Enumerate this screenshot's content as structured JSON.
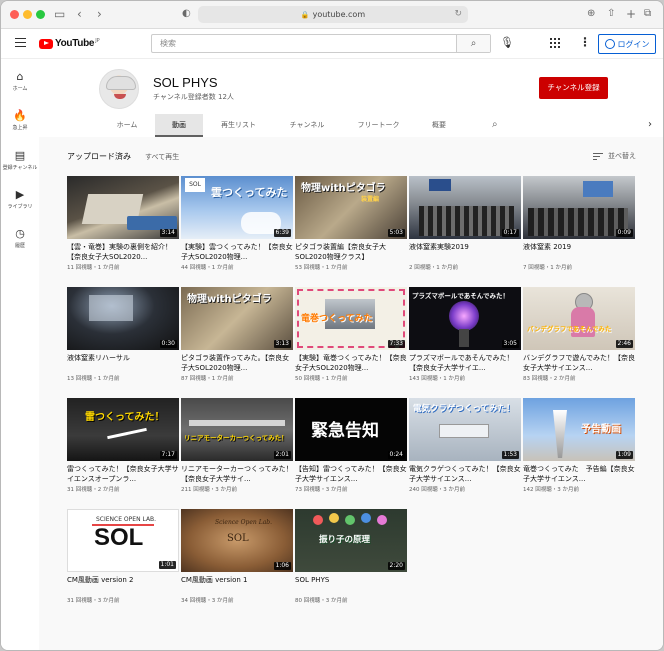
{
  "browser": {
    "url": "youtube.com"
  },
  "header": {
    "logo_text": "YouTube",
    "logo_region": "JP",
    "search_placeholder": "検索",
    "login_label": "ログイン"
  },
  "sidebar": {
    "items": [
      {
        "icon": "home-icon",
        "label": "ホーム",
        "glyph": "⌂"
      },
      {
        "icon": "explore-icon",
        "label": "急上昇",
        "glyph": "🔥"
      },
      {
        "icon": "subscriptions-icon",
        "label": "登録チャンネル",
        "glyph": "▤"
      },
      {
        "icon": "library-icon",
        "label": "ライブラリ",
        "glyph": "▶"
      },
      {
        "icon": "history-icon",
        "label": "履歴",
        "glyph": "◷"
      }
    ]
  },
  "channel": {
    "name": "SOL PHYS",
    "subscribers": "チャンネル登録者数 12人",
    "subscribe_label": "チャンネル登録",
    "tabs": [
      "ホーム",
      "動画",
      "再生リスト",
      "チャンネル",
      "フリートーク",
      "概要"
    ],
    "active_tab": 1
  },
  "videos_section": {
    "title": "アップロード済み",
    "play_all": "すべて再生",
    "sort_label": "並べ替え"
  },
  "videos": [
    {
      "title": "【雲・竜巻】実験の裏側を紹介！【奈良女子大SOL2020...",
      "meta": "11 回視聴・1 か月前",
      "duration": "3:14"
    },
    {
      "title": "【実験】雲つくってみた！【奈良女子大SOL2020物理...",
      "meta": "44 回視聴・1 か月前",
      "duration": "6:39"
    },
    {
      "title": "ピタゴラ装置編【奈良女子大SOL2020物理クラス】",
      "meta": "53 回視聴・1 か月前",
      "duration": "5:03"
    },
    {
      "title": "液体窒素実験2019",
      "meta": "2 回視聴・1 か月前",
      "duration": "0:17"
    },
    {
      "title": "液体窒素 2019",
      "meta": "7 回視聴・1 か月前",
      "duration": "0:09"
    },
    {
      "title": "液体窒素リハーサル",
      "meta": "13 回視聴・1 か月前",
      "duration": "0:30"
    },
    {
      "title": "ピタゴラ装置作ってみた。【奈良女子大SOL2020物理...",
      "meta": "87 回視聴・1 か月前",
      "duration": "3:13"
    },
    {
      "title": "【実験】竜巻つくってみた！【奈良女子大SOL2020物理...",
      "meta": "50 回視聴・1 か月前",
      "duration": "7:33"
    },
    {
      "title": "プラズマボールであそんでみた！【奈良女子大学サイエ...",
      "meta": "143 回視聴・1 か月前",
      "duration": "3:05"
    },
    {
      "title": "バンデグラフで遊んでみた！【奈良女子大学サイエンス...",
      "meta": "83 回視聴・2 か月前",
      "duration": "2:46"
    },
    {
      "title": "雷つくってみた！【奈良女子大学サイエンスオープンラ...",
      "meta": "31 回視聴・2 か月前",
      "duration": "7:17"
    },
    {
      "title": "リニアモーターカーつくってみた！【奈良女子大学サイ...",
      "meta": "211 回視聴・3 か月前",
      "duration": "2:01"
    },
    {
      "title": "【告知】雷つくってみた！【奈良女子大学サイエンス...",
      "meta": "73 回視聴・3 か月前",
      "duration": "0:24"
    },
    {
      "title": "電気クラゲつくってみた！【奈良女子大学サイエンス...",
      "meta": "240 回視聴・3 か月前",
      "duration": "1:53"
    },
    {
      "title": "竜巻つくってみた　予告編【奈良女子大学サイエンス...",
      "meta": "142 回視聴・3 か月前",
      "duration": "1:09"
    },
    {
      "title": "CM風動画 version 2",
      "meta": "31 回視聴・3 か月前",
      "duration": "1:01"
    },
    {
      "title": "CM風動画 version 1",
      "meta": "34 回視聴・3 か月前",
      "duration": "1:06"
    },
    {
      "title": "SOL PHYS",
      "meta": "80 回視聴・3 か月前",
      "duration": "2:20"
    }
  ],
  "thumb_texts": {
    "t2_a": "雲つくってみた",
    "t3_a": "物理withピタゴラ",
    "t3_b": "装置編",
    "t7_a": "物理withピタゴラ",
    "t8_a": "竜巻つくってみた",
    "t9_a": "プラズマボールであそんでみた！",
    "t10_a": "バンデグラフであそんでみた",
    "t11_a": "雷つくってみた！",
    "t12_a": "リニアモーターカーつくってみた！",
    "t13_a": "緊急告知",
    "t14_a": "電気クラゲつくってみた！",
    "t15_a": "予告動画",
    "t16_a": "SCIENCE OPEN LAB.",
    "t16_b": "SOL",
    "t17_a": "Science Open Lab.",
    "t17_b": "SOL",
    "t18_a": "振り子の原理"
  }
}
